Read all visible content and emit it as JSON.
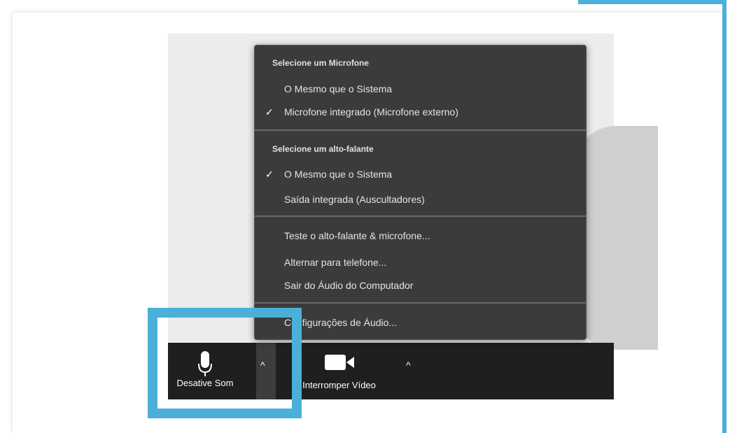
{
  "audio_menu": {
    "mic_heading": "Selecione um Microfone",
    "mic_items": [
      {
        "label": "O Mesmo que o Sistema",
        "checked": false
      },
      {
        "label": "Microfone integrado (Microfone externo)",
        "checked": true
      }
    ],
    "speaker_heading": "Selecione um alto-falante",
    "speaker_items": [
      {
        "label": "O Mesmo que o Sistema",
        "checked": true
      },
      {
        "label": "Saída integrada (Auscultadores)",
        "checked": false
      }
    ],
    "actions": [
      "Teste o alto-falante & microfone...",
      "Alternar para telefone...",
      "Sair do Áudio do Computador"
    ],
    "settings": "Configurações de Áudio...",
    "check_mark": "✓"
  },
  "toolbar": {
    "mute_label": "Desative Som",
    "video_label": "Interromper Vídeo",
    "caret_glyph": "^"
  },
  "colors": {
    "highlight": "#4bb0d9",
    "menu_bg": "#3b3b3d",
    "toolbar_bg": "#1f1f1f"
  }
}
